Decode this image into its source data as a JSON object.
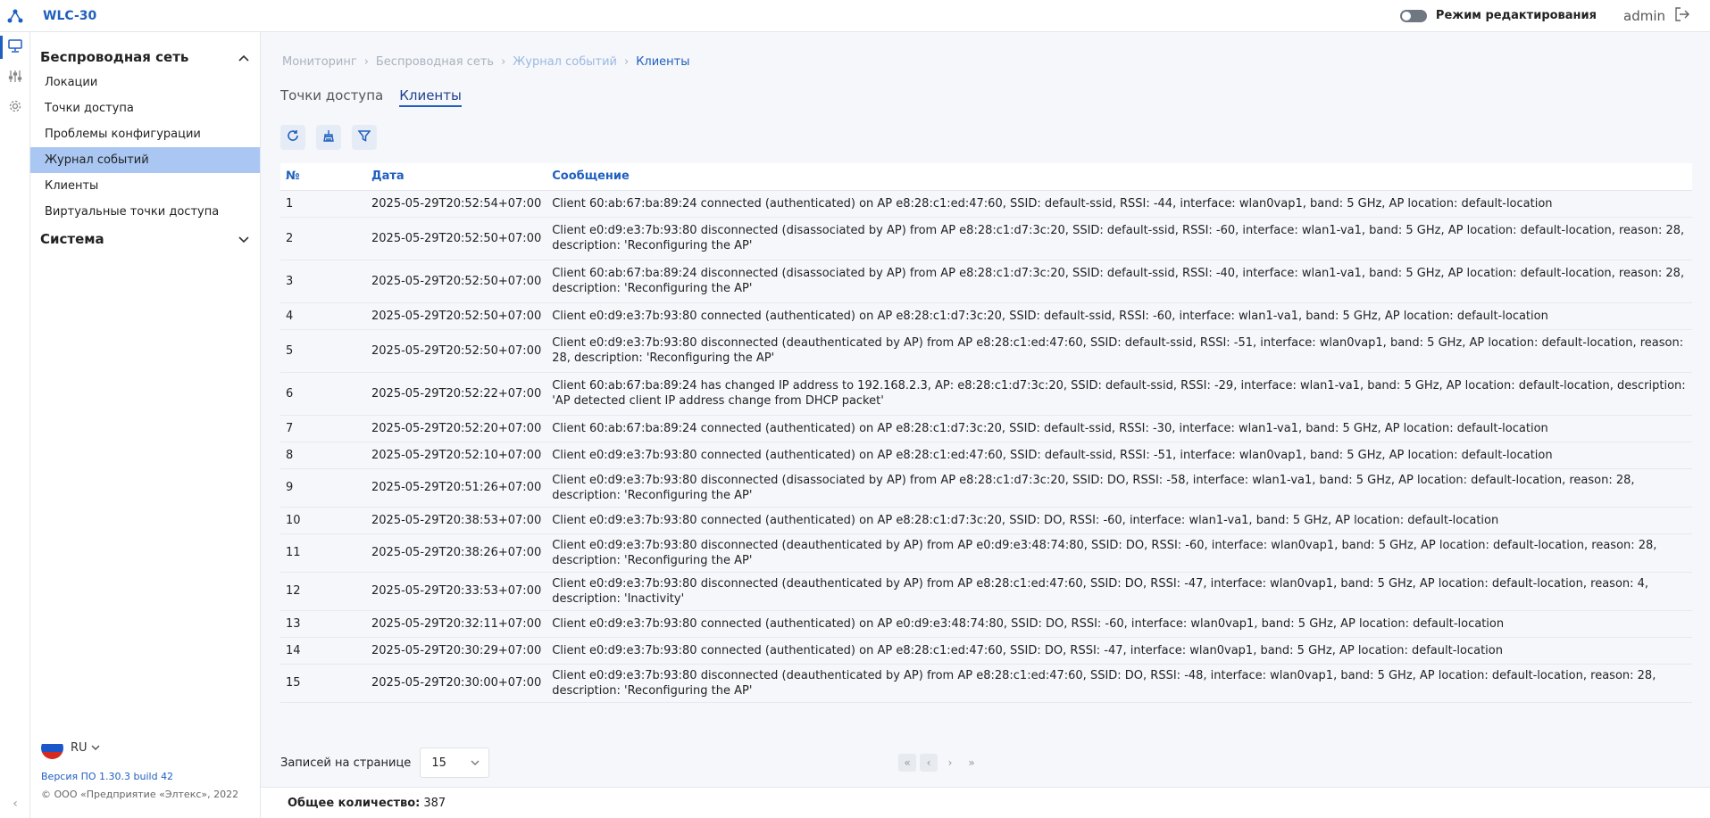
{
  "app": {
    "title": "WLC-30"
  },
  "header": {
    "edit_mode_label": "Режим редактирования",
    "user": "admin"
  },
  "sidebar": {
    "sections": [
      {
        "title": "Беспроводная сеть",
        "expanded": true,
        "items": [
          {
            "label": "Локации"
          },
          {
            "label": "Точки доступа"
          },
          {
            "label": "Проблемы конфигурации"
          },
          {
            "label": "Журнал событий",
            "active": true
          },
          {
            "label": "Клиенты"
          },
          {
            "label": "Виртуальные точки доступа"
          }
        ]
      },
      {
        "title": "Система",
        "expanded": false
      }
    ],
    "language": "RU",
    "version": "Версия ПО 1.30.3 build 42",
    "copyright": "© ООО «Предприятие «Элтекс», 2022"
  },
  "breadcrumb": [
    "Мониторинг",
    "Беспроводная сеть",
    "Журнал событий",
    "Клиенты"
  ],
  "tabs": [
    {
      "label": "Точки доступа",
      "active": false
    },
    {
      "label": "Клиенты",
      "active": true
    }
  ],
  "table": {
    "headers": [
      "№",
      "Дата",
      "Сообщение"
    ],
    "rows": [
      [
        "1",
        "2025-05-29T20:52:54+07:00",
        "Client 60:ab:67:ba:89:24 connected (authenticated) on AP e8:28:c1:ed:47:60, SSID: default-ssid, RSSI: -44, interface: wlan0vap1, band: 5 GHz, AP location: default-location"
      ],
      [
        "2",
        "2025-05-29T20:52:50+07:00",
        "Client e0:d9:e3:7b:93:80 disconnected (disassociated by AP) from AP e8:28:c1:d7:3c:20, SSID: default-ssid, RSSI: -60, interface: wlan1-va1, band: 5 GHz, AP location: default-location, reason: 28, description: 'Reconfiguring the AP'"
      ],
      [
        "3",
        "2025-05-29T20:52:50+07:00",
        "Client 60:ab:67:ba:89:24 disconnected (disassociated by AP) from AP e8:28:c1:d7:3c:20, SSID: default-ssid, RSSI: -40, interface: wlan1-va1, band: 5 GHz, AP location: default-location, reason: 28, description: 'Reconfiguring the AP'"
      ],
      [
        "4",
        "2025-05-29T20:52:50+07:00",
        "Client e0:d9:e3:7b:93:80 connected (authenticated) on AP e8:28:c1:d7:3c:20, SSID: default-ssid, RSSI: -60, interface: wlan1-va1, band: 5 GHz, AP location: default-location"
      ],
      [
        "5",
        "2025-05-29T20:52:50+07:00",
        "Client e0:d9:e3:7b:93:80 disconnected (deauthenticated by AP) from AP e8:28:c1:ed:47:60, SSID: default-ssid, RSSI: -51, interface: wlan0vap1, band: 5 GHz, AP location: default-location, reason: 28, description: 'Reconfiguring the AP'"
      ],
      [
        "6",
        "2025-05-29T20:52:22+07:00",
        "Client 60:ab:67:ba:89:24 has changed IP address to 192.168.2.3, AP: e8:28:c1:d7:3c:20, SSID: default-ssid, RSSI: -29, interface: wlan1-va1, band: 5 GHz, AP location: default-location, description: 'AP detected client IP address change from DHCP packet'"
      ],
      [
        "7",
        "2025-05-29T20:52:20+07:00",
        "Client 60:ab:67:ba:89:24 connected (authenticated) on AP e8:28:c1:d7:3c:20, SSID: default-ssid, RSSI: -30, interface: wlan1-va1, band: 5 GHz, AP location: default-location"
      ],
      [
        "8",
        "2025-05-29T20:52:10+07:00",
        "Client e0:d9:e3:7b:93:80 connected (authenticated) on AP e8:28:c1:ed:47:60, SSID: default-ssid, RSSI: -51, interface: wlan0vap1, band: 5 GHz, AP location: default-location"
      ],
      [
        "9",
        "2025-05-29T20:51:26+07:00",
        "Client e0:d9:e3:7b:93:80 disconnected (disassociated by AP) from AP e8:28:c1:d7:3c:20, SSID: DO, RSSI: -58, interface: wlan1-va1, band: 5 GHz, AP location: default-location, reason: 28, description: 'Reconfiguring the AP'"
      ],
      [
        "10",
        "2025-05-29T20:38:53+07:00",
        "Client e0:d9:e3:7b:93:80 connected (authenticated) on AP e8:28:c1:d7:3c:20, SSID: DO, RSSI: -60, interface: wlan1-va1, band: 5 GHz, AP location: default-location"
      ],
      [
        "11",
        "2025-05-29T20:38:26+07:00",
        "Client e0:d9:e3:7b:93:80 disconnected (deauthenticated by AP) from AP e0:d9:e3:48:74:80, SSID: DO, RSSI: -60, interface: wlan0vap1, band: 5 GHz, AP location: default-location, reason: 28, description: 'Reconfiguring the AP'"
      ],
      [
        "12",
        "2025-05-29T20:33:53+07:00",
        "Client e0:d9:e3:7b:93:80 disconnected (deauthenticated by AP) from AP e8:28:c1:ed:47:60, SSID: DO, RSSI: -47, interface: wlan0vap1, band: 5 GHz, AP location: default-location, reason: 4, description: 'Inactivity'"
      ],
      [
        "13",
        "2025-05-29T20:32:11+07:00",
        "Client e0:d9:e3:7b:93:80 connected (authenticated) on AP e0:d9:e3:48:74:80, SSID: DO, RSSI: -60, interface: wlan0vap1, band: 5 GHz, AP location: default-location"
      ],
      [
        "14",
        "2025-05-29T20:30:29+07:00",
        "Client e0:d9:e3:7b:93:80 connected (authenticated) on AP e8:28:c1:ed:47:60, SSID: DO, RSSI: -47, interface: wlan0vap1, band: 5 GHz, AP location: default-location"
      ],
      [
        "15",
        "2025-05-29T20:30:00+07:00",
        "Client e0:d9:e3:7b:93:80 disconnected (deauthenticated by AP) from AP e8:28:c1:ed:47:60, SSID: DO, RSSI: -48, interface: wlan0vap1, band: 5 GHz, AP location: default-location, reason: 28, description: 'Reconfiguring the AP'"
      ]
    ]
  },
  "pagination": {
    "per_page_label": "Записей на странице",
    "per_page_value": "15"
  },
  "footer": {
    "total_label": "Общее количество:",
    "total_value": "387"
  },
  "colors": {
    "accent": "#1f5fbf",
    "active_item_bg": "#a9c7f2"
  }
}
